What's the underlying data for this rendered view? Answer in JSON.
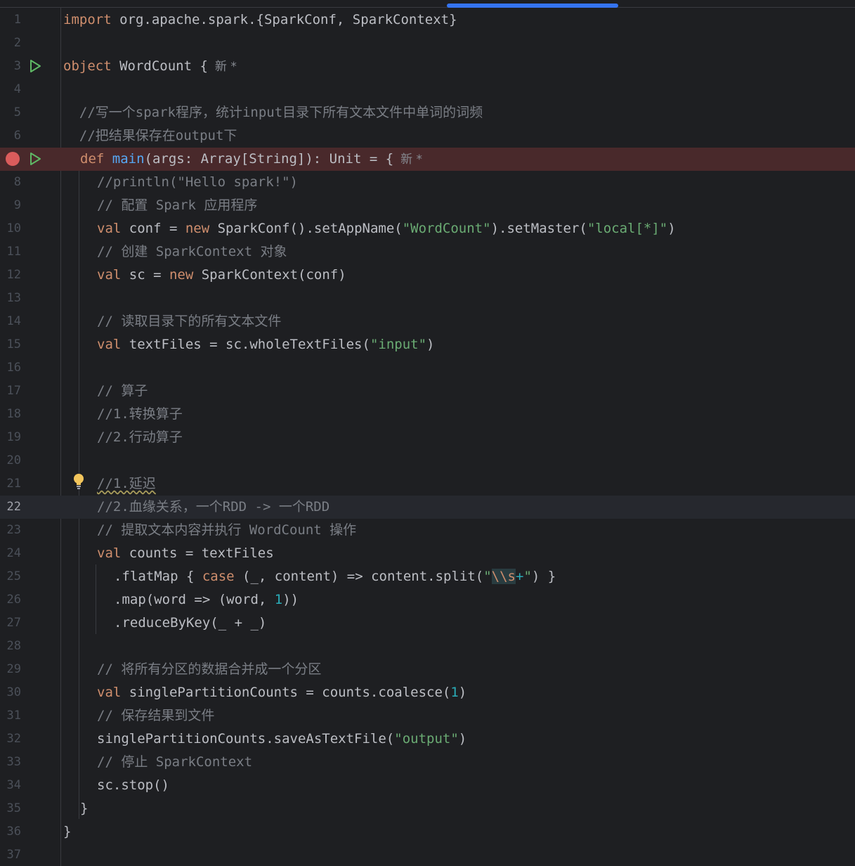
{
  "editor": {
    "lines": [
      {
        "n": "1"
      },
      {
        "n": "2"
      },
      {
        "n": "3"
      },
      {
        "n": "4"
      },
      {
        "n": "5"
      },
      {
        "n": "6"
      },
      {
        "n": "7"
      },
      {
        "n": "8"
      },
      {
        "n": "9"
      },
      {
        "n": "10"
      },
      {
        "n": "11"
      },
      {
        "n": "12"
      },
      {
        "n": "13"
      },
      {
        "n": "14"
      },
      {
        "n": "15"
      },
      {
        "n": "16"
      },
      {
        "n": "17"
      },
      {
        "n": "18"
      },
      {
        "n": "19"
      },
      {
        "n": "20"
      },
      {
        "n": "21"
      },
      {
        "n": "22"
      },
      {
        "n": "23"
      },
      {
        "n": "24"
      },
      {
        "n": "25"
      },
      {
        "n": "26"
      },
      {
        "n": "27"
      },
      {
        "n": "28"
      },
      {
        "n": "29"
      },
      {
        "n": "30"
      },
      {
        "n": "31"
      },
      {
        "n": "32"
      },
      {
        "n": "33"
      },
      {
        "n": "34"
      },
      {
        "n": "35"
      },
      {
        "n": "36"
      },
      {
        "n": "37"
      }
    ],
    "code": {
      "l1_import": "import",
      "l1_rest": " org.apache.spark.{SparkConf, SparkContext}",
      "l3_object": "object",
      "l3_rest": " WordCount {",
      "l3_hint": "新 *",
      "l5": "  //写一个spark程序，统计input目录下所有文本文件中单词的词频",
      "l6": "  //把结果保存在output下",
      "l7_def": "def",
      "l7_main": "main",
      "l7_rest": "(args: Array[String]): Unit = {",
      "l7_hint": "新 *",
      "l8": "//println(\"Hello spark!\")",
      "l9": "// 配置 Spark 应用程序",
      "l10_val": "val",
      "l10_a": " conf = ",
      "l10_new": "new",
      "l10_b": " SparkConf().setAppName(",
      "l10_s1": "\"WordCount\"",
      "l10_c": ").setMaster(",
      "l10_s2": "\"local[*]\"",
      "l10_d": ")",
      "l11": "// 创建 SparkContext 对象",
      "l12_val": "val",
      "l12_a": " sc = ",
      "l12_new": "new",
      "l12_b": " SparkContext(conf)",
      "l14": "// 读取目录下的所有文本文件",
      "l15_val": "val",
      "l15_a": " textFiles = sc.wholeTextFiles(",
      "l15_s": "\"input\"",
      "l15_b": ")",
      "l17": "// 算子",
      "l18": "//1.转换算子",
      "l19": "//2.行动算子",
      "l21": "//1.延迟",
      "l22": "//2.血缘关系，一个RDD -> 一个RDD",
      "l23": "// 提取文本内容并执行 WordCount 操作",
      "l24_val": "val",
      "l24_a": " counts = textFiles",
      "l25_a": ".flatMap { ",
      "l25_case": "case",
      "l25_b": " (_, content) => content.split(",
      "l25_q1": "\"",
      "l25_esc": "\\\\s",
      "l25_plus": "+",
      "l25_q2": "\"",
      "l25_c": ") }",
      "l26_a": ".map(word => (word, ",
      "l26_num": "1",
      "l26_b": "))",
      "l27": ".reduceByKey(_ + _)",
      "l29": "// 将所有分区的数据合并成一个分区",
      "l30_val": "val",
      "l30_a": " singlePartitionCounts = counts.coalesce(",
      "l30_num": "1",
      "l30_b": ")",
      "l31": "// 保存结果到文件",
      "l32_a": "singlePartitionCounts.saveAsTextFile(",
      "l32_s": "\"output\"",
      "l32_b": ")",
      "l33": "// 停止 SparkContext",
      "l34": "sc.stop()",
      "l35": "}",
      "l36": "}"
    }
  },
  "colors": {
    "background": "#1e1f22",
    "keyword": "#cf8e6d",
    "string": "#6aab73",
    "comment": "#7a7e85",
    "function": "#56a8f5",
    "number": "#2aacb8",
    "breakpoint": "#db5c5c",
    "run_icon": "#5fb865",
    "scroll_thumb": "#3574f0"
  },
  "icons": {
    "run": "run-gutter-icon",
    "breakpoint": "breakpoint-icon",
    "intention": "lightbulb-icon"
  }
}
